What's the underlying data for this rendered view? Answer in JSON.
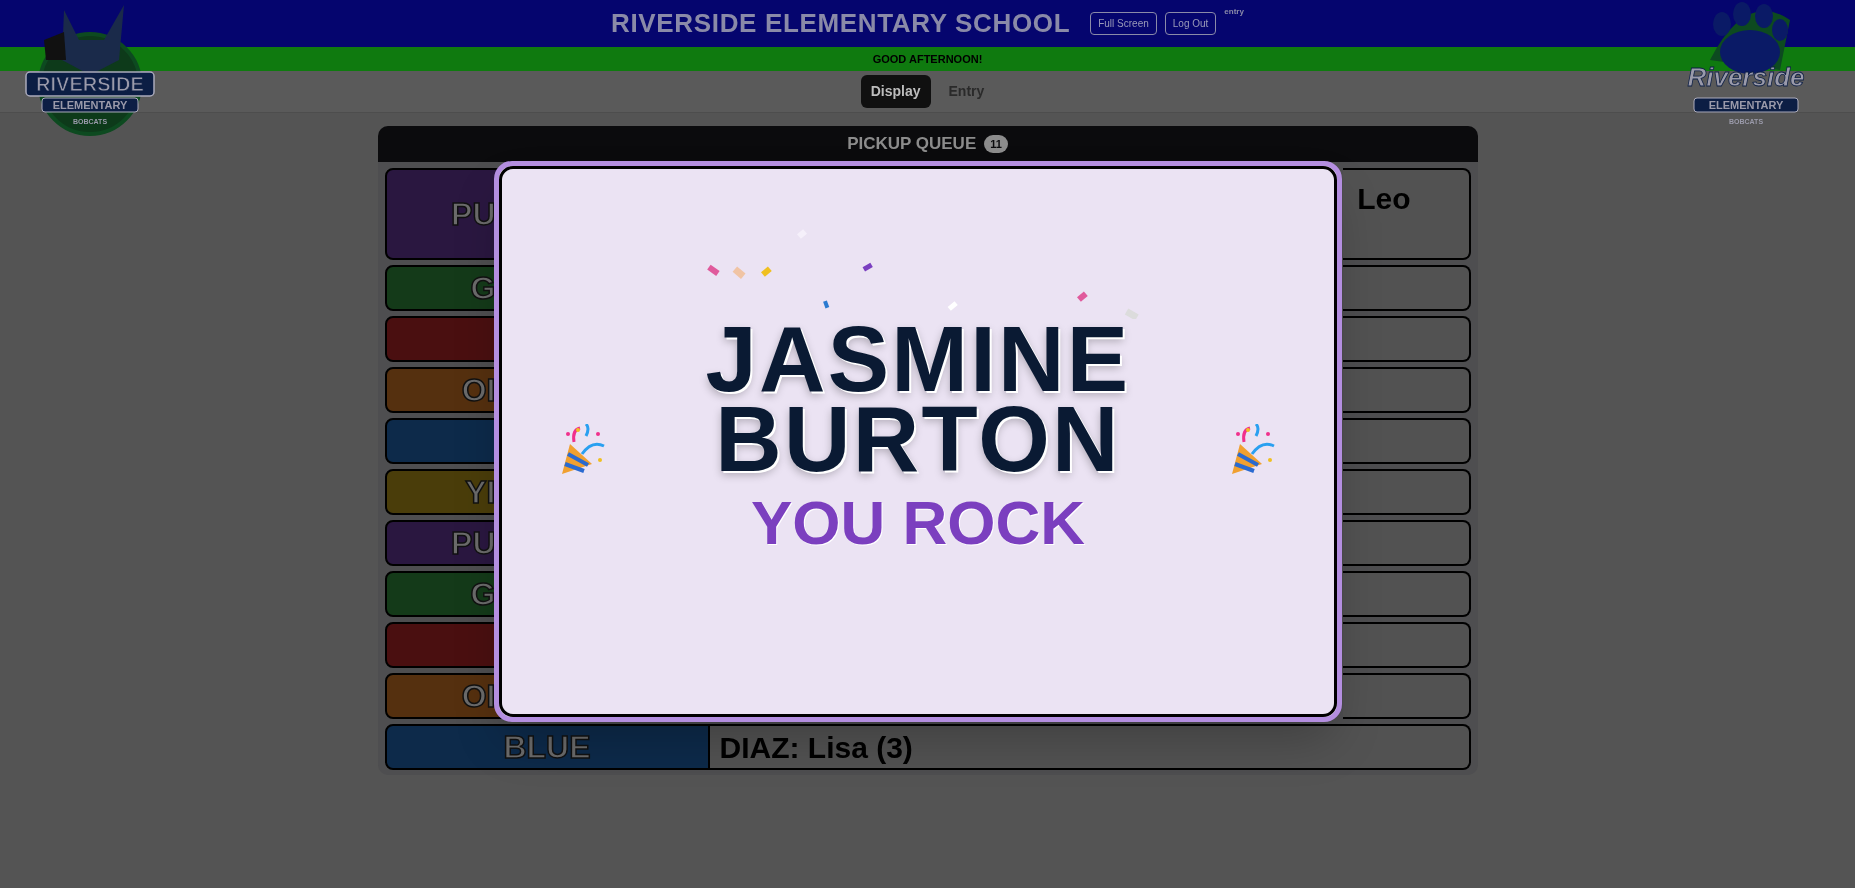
{
  "header": {
    "title": "RIVERSIDE ELEMENTARY SCHOOL",
    "buttons": [
      "Full Screen",
      "Log Out"
    ],
    "user": "entry"
  },
  "logos": [
    {
      "kind": "bobcat",
      "lines": [
        "RIVERSIDE",
        "ELEMENTARY",
        "BOBCATS"
      ]
    },
    {
      "kind": "paw",
      "lines": [
        "Riverside",
        "ELEMENTARY",
        "BOBCATS"
      ]
    }
  ],
  "greeting": "GOOD AFTERNOON!",
  "tabs": [
    {
      "label": "Display",
      "selected": true
    },
    {
      "label": "Entry",
      "selected": false
    }
  ],
  "queue": {
    "title": "PICKUP QUEUE",
    "count": "11",
    "rows": [
      {
        "label": "PU",
        "color": "#2a1740",
        "covered": true,
        "name": "Leo"
      },
      {
        "label": "G",
        "color": "#143a19",
        "covered": true
      },
      {
        "color": "#4a0f10"
      },
      {
        "label": "OI",
        "color": "#55300f",
        "covered": true
      },
      {
        "color": "#0d2a4a"
      },
      {
        "label": "YI",
        "color": "#4a3d0a",
        "covered": true
      },
      {
        "label": "PU",
        "color": "#2a1740",
        "covered": true
      },
      {
        "label": "G",
        "color": "#143a19",
        "covered": true
      },
      {
        "color": "#4a0f10"
      },
      {
        "label": "OI",
        "color": "#55300f",
        "covered": true
      },
      {
        "label": "BLUE",
        "color": "#0d2a4a",
        "covered": false,
        "name": "DIAZ: Lisa (3)"
      }
    ]
  },
  "modal": {
    "name_lines": [
      "JASMINE",
      "BURTON"
    ],
    "subtitle": "YOU ROCK"
  }
}
